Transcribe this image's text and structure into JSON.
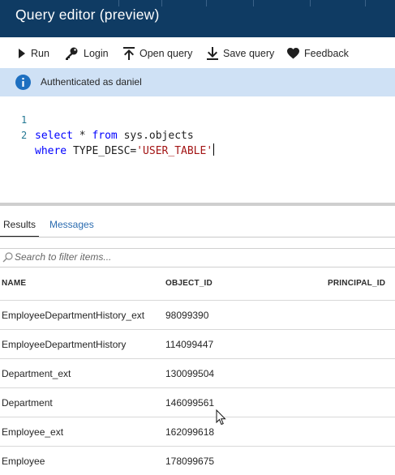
{
  "window": {
    "title": "Query editor (preview)"
  },
  "toolbar": {
    "run": "Run",
    "login": "Login",
    "open_query": "Open query",
    "save_query": "Save query",
    "feedback": "Feedback"
  },
  "banner": {
    "message": "Authenticated as daniel"
  },
  "editor": {
    "lines": [
      {
        "number": "1",
        "kw1": "select",
        "t1": " * ",
        "kw2": "from",
        "t2": " sys.objects"
      },
      {
        "number": "2",
        "kw1": "where",
        "t1": " TYPE_DESC=",
        "str": "'USER_TABLE'"
      }
    ]
  },
  "results": {
    "tabs": [
      "Results",
      "Messages"
    ],
    "active_tab": "Results",
    "filter_placeholder": "Search to filter items...",
    "columns": [
      "NAME",
      "OBJECT_ID",
      "PRINCIPAL_ID"
    ],
    "rows": [
      {
        "name": "EmployeeDepartmentHistory_ext",
        "object_id": "98099390",
        "principal_id": ""
      },
      {
        "name": "EmployeeDepartmentHistory",
        "object_id": "114099447",
        "principal_id": ""
      },
      {
        "name": "Department_ext",
        "object_id": "130099504",
        "principal_id": ""
      },
      {
        "name": "Department",
        "object_id": "146099561",
        "principal_id": ""
      },
      {
        "name": "Employee_ext",
        "object_id": "162099618",
        "principal_id": ""
      },
      {
        "name": "Employee",
        "object_id": "178099675",
        "principal_id": ""
      }
    ]
  },
  "colors": {
    "title_bar": "#0f3b63",
    "banner": "#cfe1f5",
    "info_icon": "#1d6fc0",
    "keyword": "#0000ff",
    "string": "#a31515",
    "link": "#2b6cb0"
  },
  "icons": {
    "run": "play-icon",
    "login": "key-icon",
    "open_query": "upload-icon",
    "save_query": "download-icon",
    "feedback": "heart-icon",
    "banner": "info-icon",
    "filter": "search-icon"
  }
}
